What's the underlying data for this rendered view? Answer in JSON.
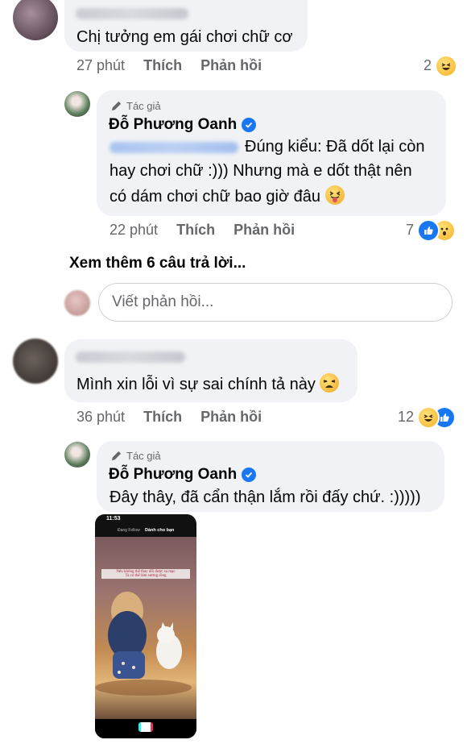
{
  "comments": [
    {
      "text": "Chị tưởng em gái chơi chữ cơ",
      "time": "27 phút",
      "like_label": "Thích",
      "reply_label": "Phản hồi",
      "reaction_count": "2"
    }
  ],
  "reply_1": {
    "author_tag": "Tác giả",
    "author_name": "Đỗ Phương Oanh",
    "line1": "Đúng kiểu: Đã dốt lại còn",
    "line2": "hay chơi chữ :))) Nhưng mà e dốt thật nên",
    "line3": "có dám chơi chữ bao giờ đâu",
    "time": "22 phút",
    "like_label": "Thích",
    "reply_label": "Phản hồi",
    "reaction_count": "7"
  },
  "see_more": "Xem thêm 6 câu trả lời...",
  "reply_box": {
    "placeholder": "Viết phản hồi..."
  },
  "comment_2": {
    "text": "Mình xin lỗi vì sự sai chính tả này",
    "time": "36 phút",
    "like_label": "Thích",
    "reply_label": "Phản hồi",
    "reaction_count": "12"
  },
  "reply_2": {
    "author_tag": "Tác giả",
    "author_name": "Đỗ Phương Oanh",
    "text": "Đây thây, đã cẩn thận lắm rồi đấy chứ. :)))))",
    "screenshot": {
      "status_time": "11:53",
      "tab_following": "Đang Follow",
      "tab_for_you": "Dành cho bạn",
      "caption_line1": "Nếu không thể thay đổi được sa mạc",
      "caption_line2": "Ta có thể làm sương rồng"
    }
  },
  "colors": {
    "accent": "#1877f2",
    "bubble": "#f0f2f5",
    "meta": "#65676b"
  },
  "icons": [
    "pen-icon",
    "verified-badge-icon",
    "haha-reaction-icon",
    "like-reaction-icon",
    "wow-reaction-icon"
  ]
}
